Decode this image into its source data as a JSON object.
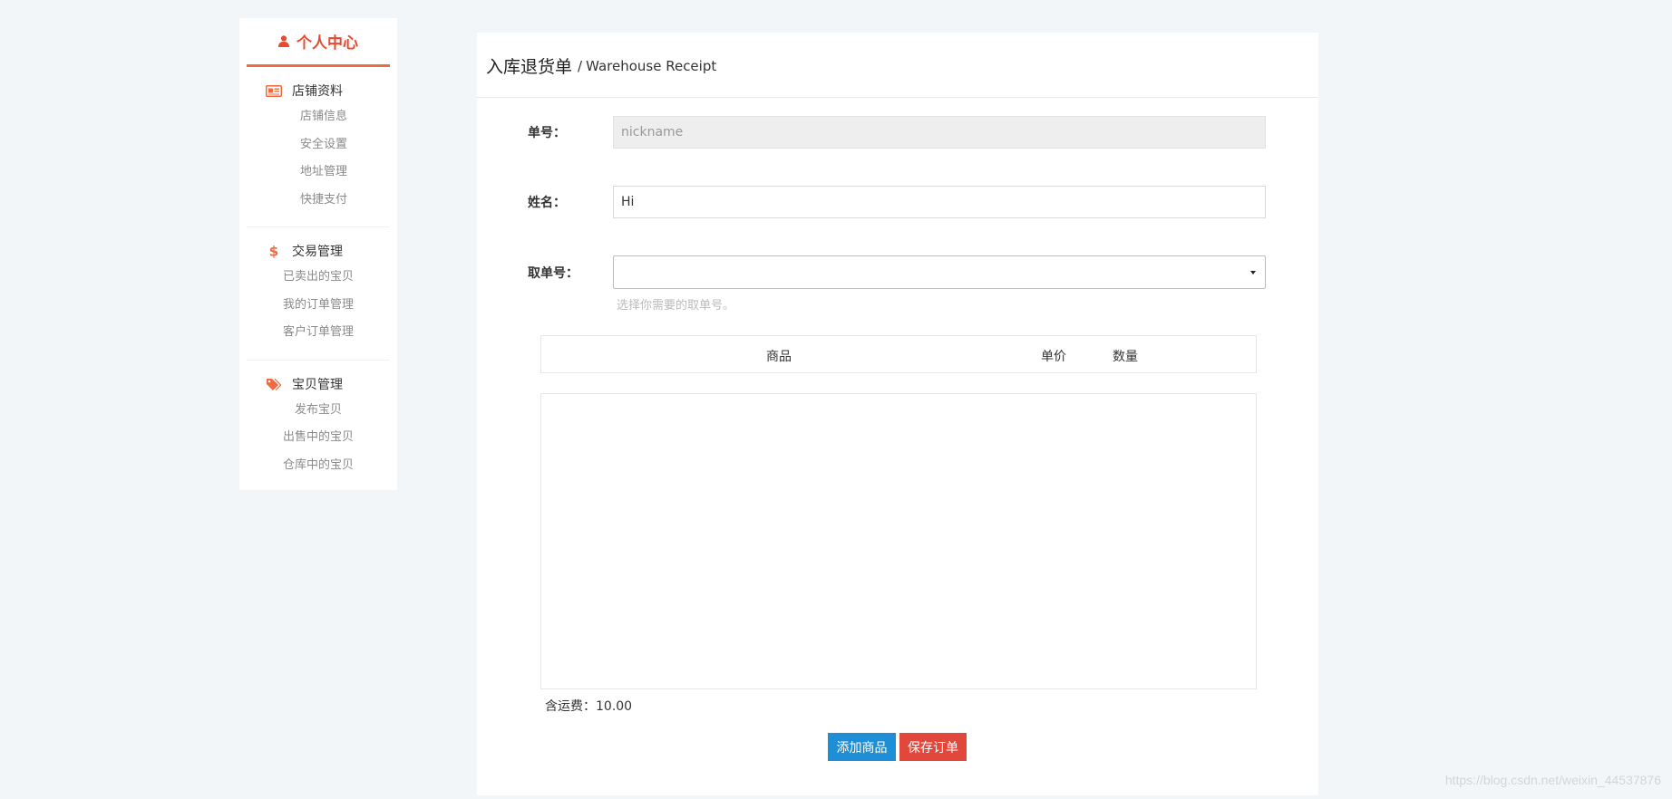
{
  "sidebar": {
    "title": "个人中心",
    "title_icon": "user-icon",
    "groups": [
      {
        "label": "店铺资料",
        "icon": "id-card-icon",
        "items": [
          "店铺信息",
          "安全设置",
          "地址管理",
          "快捷支付"
        ]
      },
      {
        "label": "交易管理",
        "icon": "dollar-icon",
        "items": [
          "已卖出的宝贝",
          "我的订单管理",
          "客户订单管理"
        ]
      },
      {
        "label": "宝贝管理",
        "icon": "tags-icon",
        "items": [
          "发布宝贝",
          "出售中的宝贝",
          "仓库中的宝贝"
        ]
      }
    ]
  },
  "main": {
    "title": "入库退货单",
    "separator": "/",
    "subtitle": "Warehouse Receipt",
    "form": {
      "order_no_label": "单号：",
      "order_no_value": "nickname",
      "name_label": "姓名：",
      "name_value": "Hi",
      "pickup_label": "取单号：",
      "pickup_value": "",
      "pickup_help": "选择你需要的取单号。"
    },
    "table": {
      "headers": [
        "商品",
        "单价",
        "数量"
      ],
      "rows": []
    },
    "shipping_text": "含运费：10.00",
    "buttons": {
      "add_label": "添加商品",
      "save_label": "保存订单"
    }
  },
  "watermark": "https://blog.csdn.net/weixin_44537876",
  "colors": {
    "accent": "#f06a3f",
    "title_red": "#e84a2f",
    "button_blue": "#1e8fd6",
    "button_red": "#e2473c",
    "background": "#f3f6f9"
  }
}
